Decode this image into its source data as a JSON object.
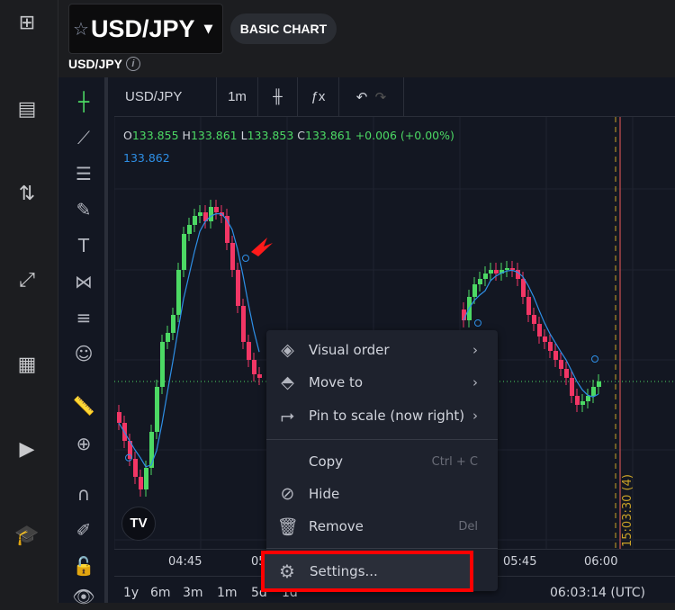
{
  "header": {
    "symbol": "USD/JPY",
    "basic_chart": "BASIC CHART",
    "sub_label": "USD/JPY",
    "info_icon": "i"
  },
  "toolbar": {
    "symbol": "USD/JPY",
    "interval": "1m",
    "fx": "ƒx"
  },
  "legend": {
    "o_label": "O",
    "o": "133.855",
    "h_label": "H",
    "h": "133.861",
    "l_label": "L",
    "l": "133.853",
    "c_label": "C",
    "c": "133.861",
    "change": "+0.006 (+0.00%)",
    "ma": "133.862"
  },
  "time_axis": [
    "04:45",
    "05",
    "05:45",
    "06:00"
  ],
  "vertical_label": "15:03:30 (4)",
  "bottom": {
    "ranges": [
      "1y",
      "6m",
      "3m",
      "1m",
      "5d",
      "1d"
    ],
    "clock": "06:03:14 (UTC)"
  },
  "context_menu": {
    "items": [
      {
        "label": "Visual order",
        "icon": "layers-icon",
        "submenu": true
      },
      {
        "label": "Move to",
        "icon": "move-to-icon",
        "submenu": true
      },
      {
        "label": "Pin to scale (now right)",
        "icon": "pin-scale-icon",
        "submenu": true
      },
      {
        "label": "Copy",
        "shortcut": "Ctrl + C"
      },
      {
        "label": "Hide",
        "icon": "eye-off-icon"
      },
      {
        "label": "Remove",
        "icon": "trash-icon",
        "shortcut": "Del"
      }
    ],
    "settings": "Settings..."
  },
  "colors": {
    "up": "#4cd964",
    "down": "#f23665",
    "ma": "#2e8fe6",
    "highlight": "#ff0000"
  },
  "chart_data": {
    "type": "candlestick",
    "current_price": 133.861,
    "segment1_closes": [
      133.8587,
      133.8577,
      133.8567,
      133.8557,
      133.855,
      133.8562,
      133.8582,
      133.8607,
      133.8632,
      133.8637,
      133.8647,
      133.8672,
      133.8692,
      133.8697,
      133.8702,
      133.8704,
      133.8699,
      133.8707,
      133.8704,
      133.8702,
      133.8687,
      133.8672,
      133.8652,
      133.8632,
      133.8622,
      133.8614,
      133.8612
    ],
    "segment2_closes": [
      133.8644,
      133.8657,
      133.8664,
      133.8667,
      133.867,
      133.8672,
      133.867,
      133.8672,
      133.8673,
      133.8672,
      133.8667,
      133.8657,
      133.8647,
      133.8642,
      133.8635,
      133.8632,
      133.8627,
      133.8622,
      133.8617,
      133.8612,
      133.8602,
      133.8597,
      133.8599,
      133.8602,
      133.8607,
      133.861
    ]
  }
}
